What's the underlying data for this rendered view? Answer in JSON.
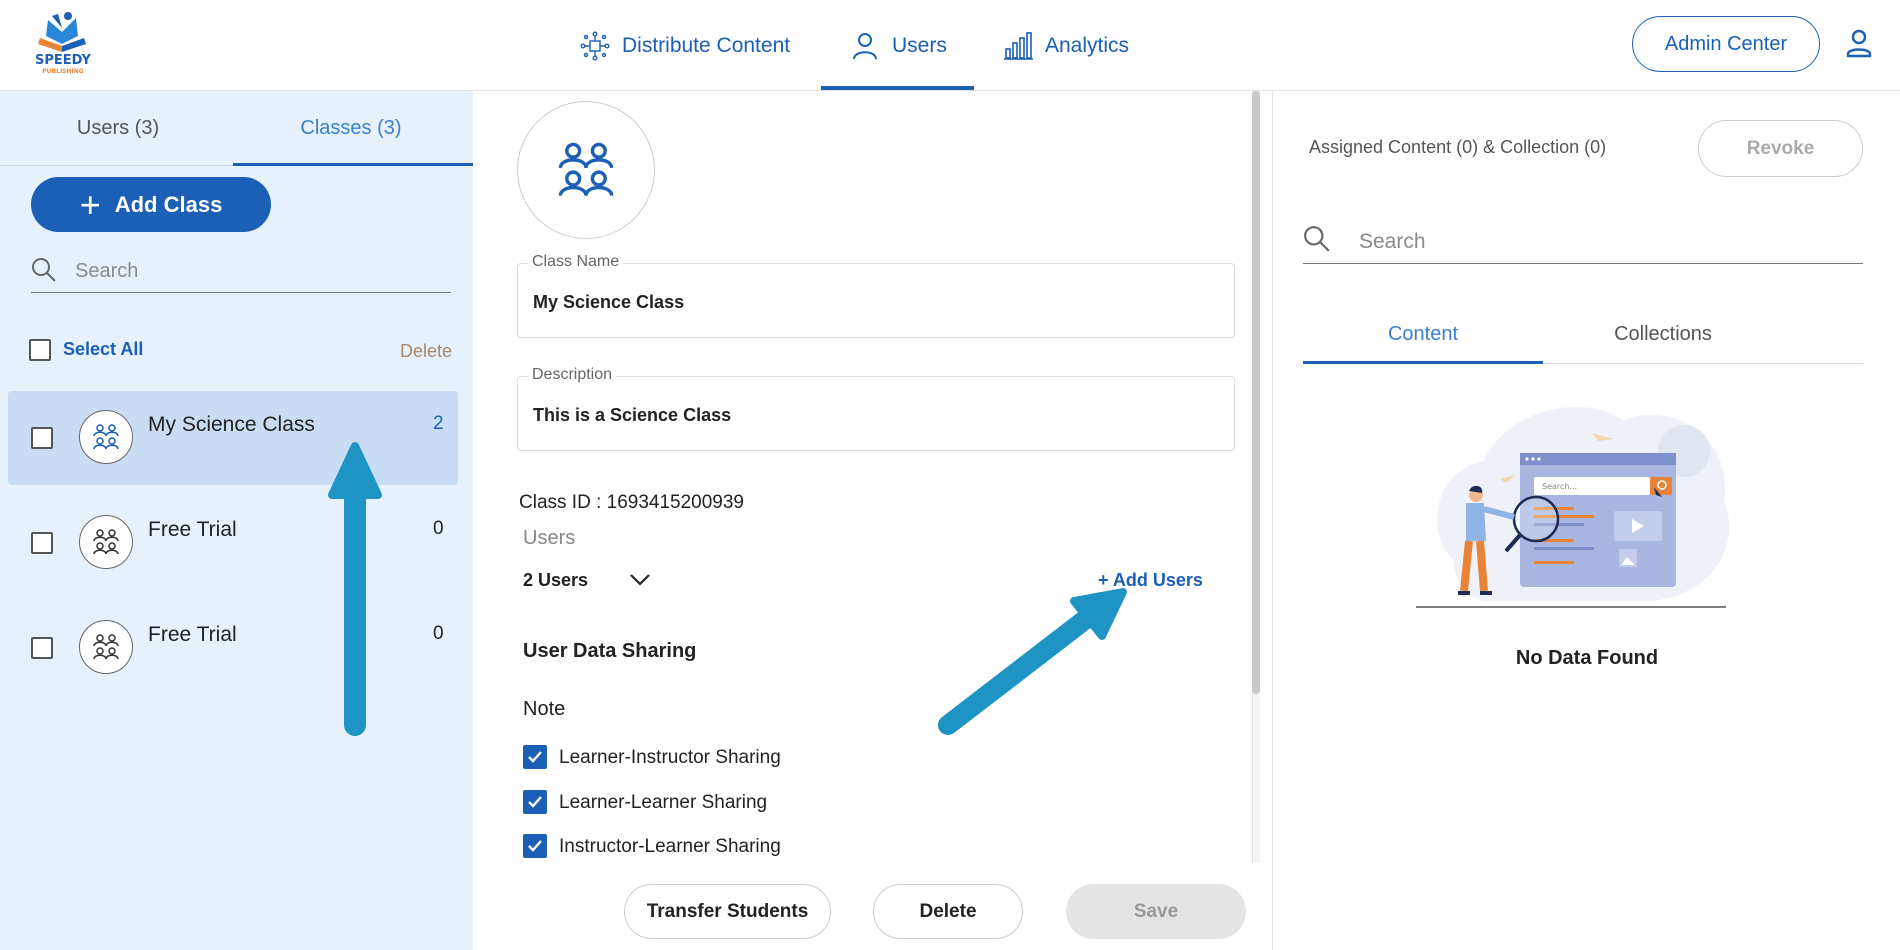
{
  "brand": {
    "logo_text": "SPEEDY",
    "logo_sub": "PUBLISHING"
  },
  "nav": {
    "distribute": "Distribute Content",
    "users": "Users",
    "analytics": "Analytics",
    "active": "Users"
  },
  "header": {
    "admin_center": "Admin Center"
  },
  "left": {
    "tabs": [
      {
        "label": "Users (3)"
      },
      {
        "label": "Classes (3)",
        "active": true
      }
    ],
    "add_class": "Add Class",
    "search_placeholder": "Search",
    "select_all": "Select All",
    "delete": "Delete",
    "classes": [
      {
        "name": "My Science Class",
        "count": "2",
        "selected": true
      },
      {
        "name": "Free Trial",
        "count": "0"
      },
      {
        "name": "Free Trial",
        "count": "0"
      }
    ]
  },
  "detail": {
    "class_name_label": "Class Name",
    "class_name": "My Science Class",
    "description_label": "Description",
    "description": "This is a Science Class",
    "class_id": "Class ID : 1693415200939",
    "users_label": "Users",
    "users_count": "2 Users",
    "add_users": "+ Add Users",
    "sharing_title": "User Data Sharing",
    "note": "Note",
    "sharing_options": [
      {
        "label": "Learner-Instructor Sharing",
        "checked": true
      },
      {
        "label": "Learner-Learner Sharing",
        "checked": true
      },
      {
        "label": "Instructor-Learner Sharing",
        "checked": true
      }
    ],
    "buttons": {
      "transfer": "Transfer Students",
      "delete": "Delete",
      "save": "Save"
    }
  },
  "right": {
    "assigned": "Assigned Content (0) & Collection (0)",
    "revoke": "Revoke",
    "search_placeholder": "Search",
    "tabs": [
      {
        "label": "Content",
        "active": true
      },
      {
        "label": "Collections"
      }
    ],
    "empty_text": "No Data Found",
    "illustration_search_text": "Search..."
  },
  "colors": {
    "primary": "#1b5fb6",
    "left_panel_bg": "#e6f1fc",
    "selected_row_bg": "#c8dcf3",
    "annotation_arrow": "#1e94c4"
  }
}
